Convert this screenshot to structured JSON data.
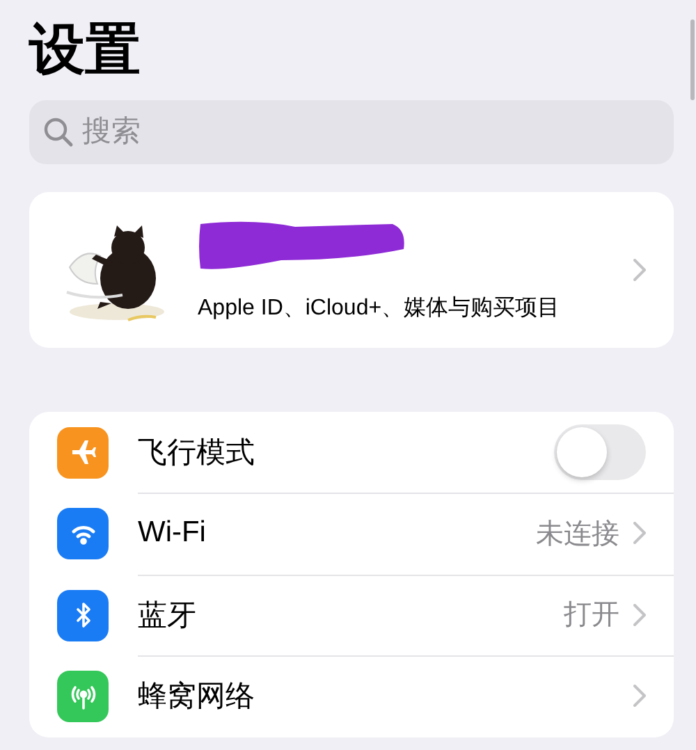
{
  "title": "设置",
  "search": {
    "placeholder": "搜索"
  },
  "profile": {
    "subtitle": "Apple ID、iCloud+、媒体与购买项目",
    "name_redacted": true
  },
  "settings": [
    {
      "kind": "toggle",
      "label": "飞行模式",
      "color": "#f7931e",
      "on": false
    },
    {
      "kind": "link",
      "label": "Wi-Fi",
      "color": "#1a7cf5",
      "value": "未连接"
    },
    {
      "kind": "link",
      "label": "蓝牙",
      "color": "#1a7cf5",
      "value": "打开"
    },
    {
      "kind": "link",
      "label": "蜂窝网络",
      "color": "#34c759"
    }
  ]
}
